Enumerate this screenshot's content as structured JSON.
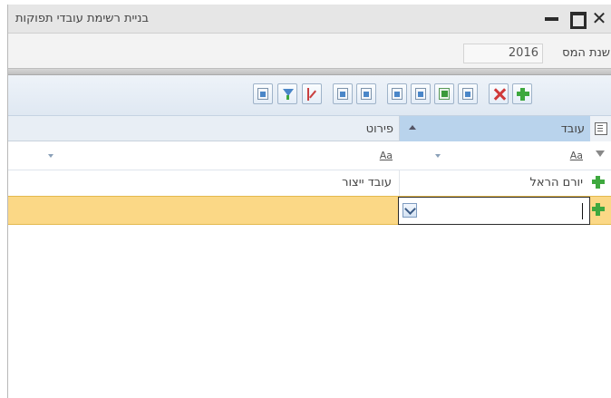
{
  "window": {
    "title": "בניית רשימת עובדי תפוקות"
  },
  "filters": {
    "year_label": "שנת המס",
    "year_value": "2016"
  },
  "grid": {
    "columns": [
      {
        "label": "עובד",
        "filter_hint": "Aa"
      },
      {
        "label": "פירוט",
        "filter_hint": "Aa"
      }
    ],
    "rows": [
      {
        "oved": "יורם הראל",
        "perut": "עובד ייצור"
      }
    ],
    "new_row": {
      "oved_value": ""
    }
  },
  "colors": {
    "selected_header": "#b9d3ec",
    "new_row_highlight": "#fbd886",
    "add_icon": "#3ea83e",
    "delete_icon": "#d03a3a"
  },
  "icons": [
    "add-icon",
    "delete-icon",
    "export-icon",
    "edit-icon",
    "report-icon",
    "view-icon",
    "copy-icon",
    "sheet-icon",
    "edit-pencil-icon",
    "filter-icon",
    "print-icon"
  ]
}
